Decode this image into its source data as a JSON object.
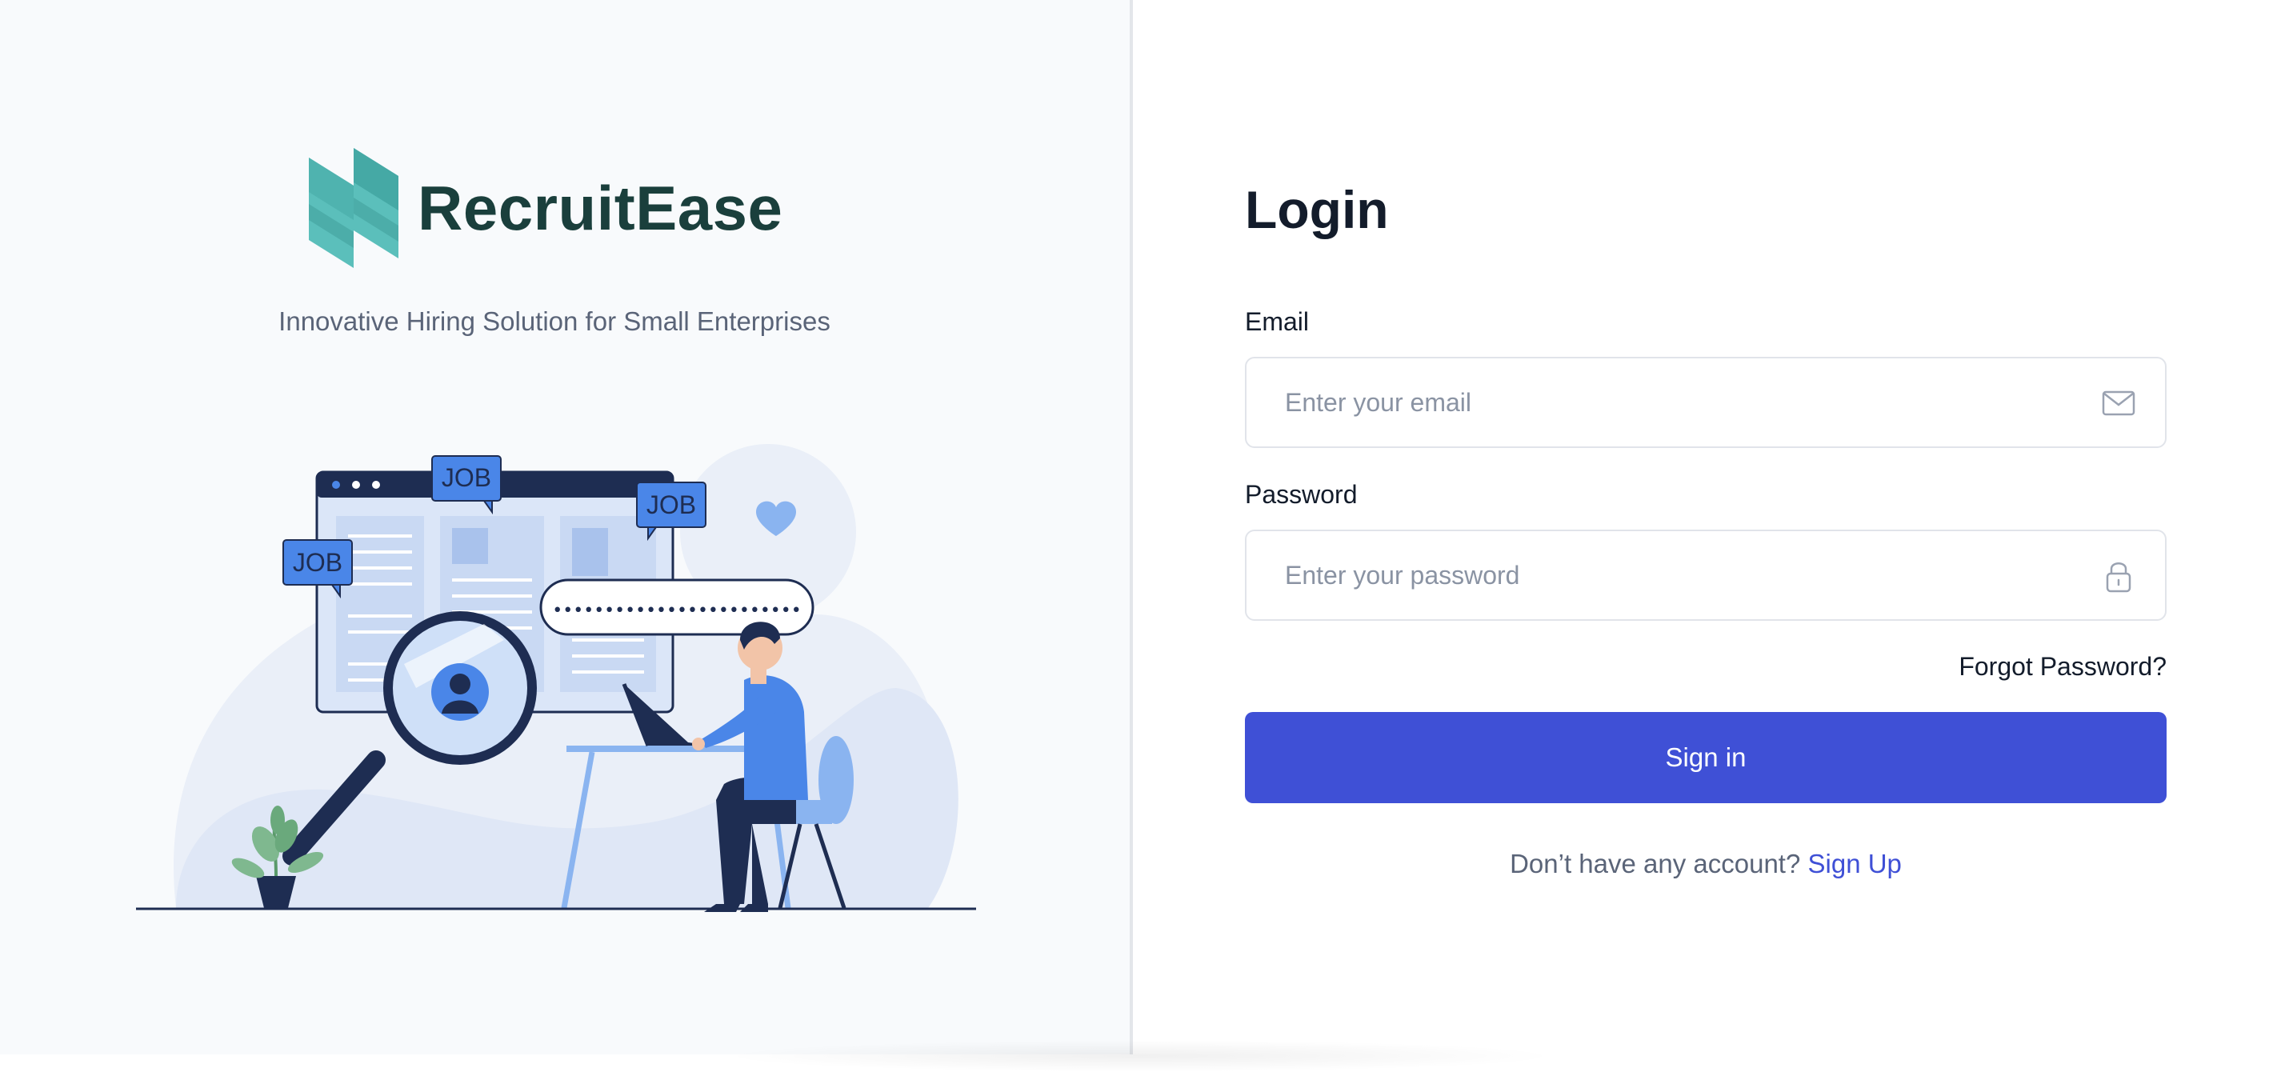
{
  "brand": {
    "name": "RecruitEase",
    "tagline": "Innovative Hiring Solution for Small Enterprises",
    "logo_colors": [
      "#5bbfbb",
      "#45a9a5",
      "#1a3f3c"
    ]
  },
  "illustration": {
    "job_tag": "JOB",
    "password_dots": "••••••••••••••••••••••••",
    "accent": "#4a86e8"
  },
  "login": {
    "title": "Login",
    "email": {
      "label": "Email",
      "placeholder": "Enter your email",
      "value": "",
      "icon": "mail-icon"
    },
    "password": {
      "label": "Password",
      "placeholder": "Enter your password",
      "value": "",
      "icon": "lock-icon"
    },
    "forgot_label": "Forgot Password?",
    "submit_label": "Sign in",
    "signup_prompt": "Don’t have any account?",
    "signup_link": "Sign Up",
    "accent": "#3f50d6"
  }
}
